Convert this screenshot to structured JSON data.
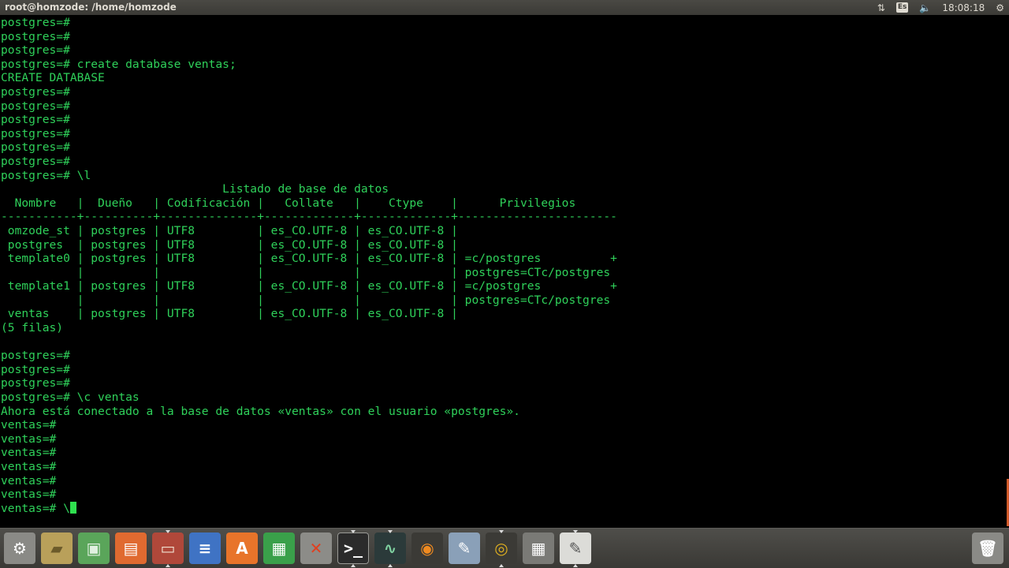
{
  "window": {
    "title": "root@homzode: /home/homzode"
  },
  "panel": {
    "keyboard_layout": "Es",
    "network_glyph": "⇅",
    "volume_glyph": "🔈",
    "settings_glyph": "⚙",
    "clock": "18:08:18"
  },
  "terminal": {
    "lines": [
      "postgres=#",
      "postgres=#",
      "postgres=#",
      "postgres=# create database ventas;",
      "CREATE DATABASE",
      "postgres=#",
      "postgres=#",
      "postgres=#",
      "postgres=#",
      "postgres=#",
      "postgres=#",
      "postgres=# \\l",
      "                                Listado de base de datos",
      "  Nombre   |  Dueño   | Codificación |   Collate   |    Ctype    |      Privilegios",
      "-----------+----------+--------------+-------------+-------------+-----------------------",
      " omzode_st | postgres | UTF8         | es_CO.UTF-8 | es_CO.UTF-8 |",
      " postgres  | postgres | UTF8         | es_CO.UTF-8 | es_CO.UTF-8 |",
      " template0 | postgres | UTF8         | es_CO.UTF-8 | es_CO.UTF-8 | =c/postgres          +",
      "           |          |              |             |             | postgres=CTc/postgres",
      " template1 | postgres | UTF8         | es_CO.UTF-8 | es_CO.UTF-8 | =c/postgres          +",
      "           |          |              |             |             | postgres=CTc/postgres",
      " ventas    | postgres | UTF8         | es_CO.UTF-8 | es_CO.UTF-8 |",
      "(5 filas)",
      "",
      "postgres=#",
      "postgres=#",
      "postgres=#",
      "postgres=# \\c ventas",
      "Ahora está conectado a la base de datos «ventas» con el usuario «postgres».",
      "ventas=#",
      "ventas=#",
      "ventas=#",
      "ventas=#",
      "ventas=#",
      "ventas=#"
    ],
    "current_prompt": "ventas=# \\"
  },
  "dock": {
    "items": [
      {
        "name": "system-settings-icon",
        "glyph": "⚙",
        "bg": "#8a8a86",
        "fg": "#ffffff",
        "running": false
      },
      {
        "name": "file-manager-icon",
        "glyph": "▰",
        "bg": "#b9a05a",
        "fg": "#6b5a2a",
        "running": false
      },
      {
        "name": "android-icon",
        "glyph": "▣",
        "bg": "#5aa55a",
        "fg": "#e0f0e0",
        "running": false
      },
      {
        "name": "presentation-icon",
        "glyph": "▤",
        "bg": "#e06a30",
        "fg": "#ffffff",
        "running": false
      },
      {
        "name": "archive-manager-icon",
        "glyph": "▭",
        "bg": "#b0483a",
        "fg": "#f0e0d0",
        "running": true
      },
      {
        "name": "text-document-icon",
        "glyph": "≡",
        "bg": "#3f73c4",
        "fg": "#ffffff",
        "running": false
      },
      {
        "name": "software-center-icon",
        "glyph": "A",
        "bg": "#e8742a",
        "fg": "#ffffff",
        "running": false
      },
      {
        "name": "spreadsheet-icon",
        "glyph": "▦",
        "bg": "#3aa04a",
        "fg": "#ffffff",
        "running": false
      },
      {
        "name": "system-tools-icon",
        "glyph": "✕",
        "bg": "#8c8c88",
        "fg": "#e04020",
        "running": false
      },
      {
        "name": "terminal-icon",
        "glyph": ">_",
        "bg": "#2b2b2b",
        "fg": "#ffffff",
        "running": true,
        "active": true
      },
      {
        "name": "system-monitor-icon",
        "glyph": "∿",
        "bg": "#2b3a3a",
        "fg": "#7fd0a0",
        "running": true
      },
      {
        "name": "blender-icon",
        "glyph": "◉",
        "bg": "#3b3a36",
        "fg": "#f08a20",
        "running": false
      },
      {
        "name": "vector-editor-icon",
        "glyph": "✎",
        "bg": "#8aa0b8",
        "fg": "#ffffff",
        "running": false
      },
      {
        "name": "chrome-icon",
        "glyph": "◎",
        "bg": "#3b3a36",
        "fg": "#e0b020",
        "running": true
      },
      {
        "name": "calculator-icon",
        "glyph": "▦",
        "bg": "#7a7a76",
        "fg": "#ffffff",
        "running": false
      },
      {
        "name": "text-editor-icon",
        "glyph": "✎",
        "bg": "#dcdcd8",
        "fg": "#555555",
        "running": true
      }
    ],
    "trash": {
      "name": "trash-icon",
      "glyph": "🗑",
      "bg": "#8a8a86",
      "fg": "#ffffff"
    }
  }
}
